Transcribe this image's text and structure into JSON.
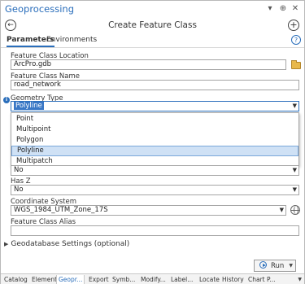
{
  "pane": {
    "title": "Geoprocessing",
    "menu_glyph": "▾",
    "pin_glyph": "⊕",
    "close_glyph": "✕"
  },
  "tool": {
    "back_glyph": "←",
    "title": "Create Feature Class",
    "add_glyph": "+"
  },
  "tabs": {
    "parameters": "Parameters",
    "environments": "Environments",
    "help_glyph": "?"
  },
  "params": {
    "location_label": "Feature Class Location",
    "location_value": "ArcPro.gdb",
    "name_label": "Feature Class Name",
    "name_value": "road_network",
    "geometry_label": "Geometry Type",
    "geometry_value": "Polyline",
    "geometry_options": [
      "Point",
      "Multipoint",
      "Polygon",
      "Polyline",
      "Multipatch"
    ],
    "geometry_selected_index": 3,
    "hasm_value": "No",
    "hasz_label": "Has Z",
    "hasz_value": "No",
    "coord_label": "Coordinate System",
    "coord_value": "WGS_1984_UTM_Zone_17S",
    "alias_label": "Feature Class Alias",
    "alias_value": ""
  },
  "geodb_settings": "Geodatabase Settings (optional)",
  "run_label": "Run",
  "bottom_tabs": [
    "Catalog",
    "Element",
    "Geopr...",
    "Export",
    "Symb...",
    "Modify...",
    "Label...",
    "Locate",
    "History",
    "Chart P..."
  ],
  "active_bottom_tab": "Geopr...",
  "colors": {
    "accent": "#2a6ebb",
    "selection": "#3a78c6",
    "hover": "#cfe1f5"
  }
}
